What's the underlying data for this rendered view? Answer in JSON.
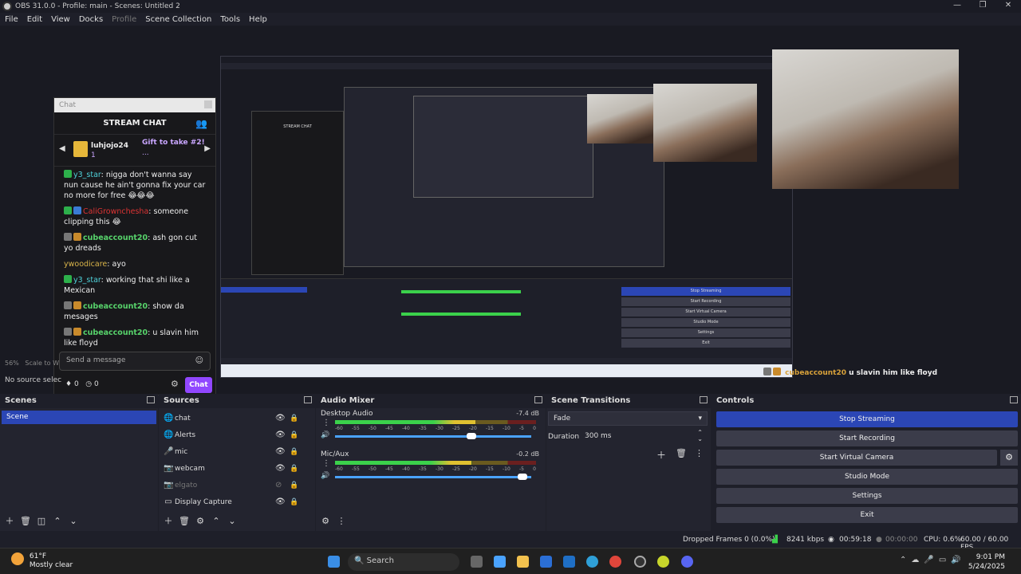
{
  "window": {
    "title": "OBS 31.0.0 - Profile: main - Scenes: Untitled 2",
    "controls": [
      "—",
      "❐",
      "✕"
    ]
  },
  "menu": [
    "File",
    "Edit",
    "View",
    "Docks",
    "Profile",
    "Scene Collection",
    "Tools",
    "Help"
  ],
  "chat_window": {
    "title": "Chat",
    "header": "STREAM CHAT",
    "pinned": {
      "user": "luhjojo24",
      "count": "1",
      "gift_line1": "Gift to take #2!",
      "gift_line2": "..."
    },
    "messages": [
      {
        "user": "y3_star",
        "user_color": "cyan",
        "text": ": nigga don't wanna say nun cause he ain't gonna fix your car no more for free 😂😂😂"
      },
      {
        "user": "CaliGrownchesha",
        "user_color": "red",
        "text": ": someone clipping this 😂"
      },
      {
        "user": "cubeaccount20",
        "user_color": "green",
        "text": ": ash gon cut yo dreads"
      },
      {
        "user": "ywoodicare",
        "user_color": "yellow",
        "text": ": ayo"
      },
      {
        "user": "y3_star",
        "user_color": "cyan",
        "text": ": working that shi like a Mexican"
      },
      {
        "user": "cubeaccount20",
        "user_color": "green",
        "text": ": show da mesages"
      },
      {
        "user": "cubeaccount20",
        "user_color": "green",
        "text": ": u slavin him like floyd"
      }
    ],
    "send_placeholder": "Send a message",
    "points": "0",
    "points2": "0",
    "chat_button": "Chat"
  },
  "preview": {
    "zoom_label": "56%",
    "zoom_text": "Scale to W",
    "no_source": "No source selec",
    "overlay_user": "cubeaccount20",
    "overlay_text": "u slavin him like floyd"
  },
  "nested_labels": {
    "stream_chat": "STREAM CHAT",
    "stop_streaming": "Stop Streaming",
    "start_recording": "Start Recording",
    "start_virtual_camera": "Start Virtual Camera",
    "studio_mode": "Studio Mode",
    "settings": "Settings",
    "exit": "Exit"
  },
  "docks": {
    "scenes": {
      "title": "Scenes",
      "items": [
        "Scene"
      ]
    },
    "sources": {
      "title": "Sources",
      "items": [
        {
          "name": "chat",
          "icon": "globe-icon",
          "glyph": "🌐",
          "dim": false
        },
        {
          "name": "Alerts",
          "icon": "globe-icon",
          "glyph": "🌐",
          "dim": false
        },
        {
          "name": "mic",
          "icon": "mic-icon",
          "glyph": "🎤",
          "dim": false
        },
        {
          "name": "webcam",
          "icon": "camera-icon",
          "glyph": "📷",
          "dim": false
        },
        {
          "name": "elgato",
          "icon": "camera-icon",
          "glyph": "📷",
          "dim": true
        },
        {
          "name": "Display Capture",
          "icon": "monitor-icon",
          "glyph": "🖵",
          "dim": false
        }
      ]
    },
    "mixer": {
      "title": "Audio Mixer",
      "channels": [
        {
          "name": "Desktop Audio",
          "db": "-7.4 dB",
          "level": 0.7,
          "volume": 0.72
        },
        {
          "name": "Mic/Aux",
          "db": "-0.2 dB",
          "level": 0.68,
          "volume": 0.98
        }
      ],
      "ticks": [
        "-60",
        "-55",
        "-50",
        "-45",
        "-40",
        "-35",
        "-30",
        "-25",
        "-20",
        "-15",
        "-10",
        "-5",
        "0"
      ]
    },
    "transitions": {
      "title": "Scene Transitions",
      "transition": "Fade",
      "duration_label": "Duration",
      "duration_value": "300 ms"
    },
    "controls": {
      "title": "Controls",
      "buttons": [
        "Stop Streaming",
        "Start Recording",
        "Start Virtual Camera",
        "Studio Mode",
        "Settings",
        "Exit"
      ]
    }
  },
  "status": {
    "dropped": "Dropped Frames 0 (0.0%)",
    "bitrate": "8241 kbps",
    "stream_time": "00:59:18",
    "rec_time": "00:00:00",
    "cpu": "CPU: 0.6%",
    "fps": "60.00 / 60.00 FPS"
  },
  "taskbar": {
    "weather_temp": "61°F",
    "weather_desc": "Mostly clear",
    "search": "Search",
    "time": "9:01 PM",
    "date": "5/24/2025"
  }
}
